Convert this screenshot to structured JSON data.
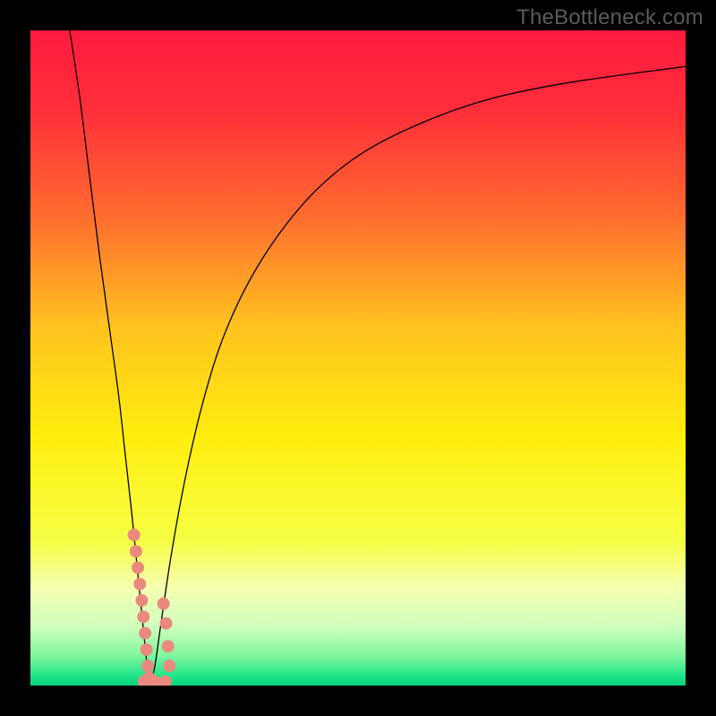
{
  "watermark": "TheBottleneck.com",
  "chart_data": {
    "type": "line",
    "title": "",
    "xlabel": "",
    "ylabel": "",
    "xlim": [
      0,
      100
    ],
    "ylim": [
      0,
      100
    ],
    "grid": false,
    "background_gradient": {
      "stops": [
        {
          "offset": 0.0,
          "color": "#ff1a3f"
        },
        {
          "offset": 0.12,
          "color": "#ff2e3a"
        },
        {
          "offset": 0.28,
          "color": "#ff6a2f"
        },
        {
          "offset": 0.45,
          "color": "#ffc21f"
        },
        {
          "offset": 0.62,
          "color": "#ffee0e"
        },
        {
          "offset": 0.78,
          "color": "#f6ff45"
        },
        {
          "offset": 0.85,
          "color": "#f6ffb0"
        },
        {
          "offset": 0.91,
          "color": "#d0ffbf"
        },
        {
          "offset": 0.955,
          "color": "#7ff59e"
        },
        {
          "offset": 0.985,
          "color": "#1fe58a"
        },
        {
          "offset": 1.0,
          "color": "#06d27a"
        }
      ]
    },
    "series": [
      {
        "name": "left-branch",
        "type": "line",
        "color": "#000000",
        "stroke_width": 1.3,
        "points": [
          {
            "x": 6.0,
            "y": 100.0
          },
          {
            "x": 7.5,
            "y": 90.0
          },
          {
            "x": 9.0,
            "y": 78.0
          },
          {
            "x": 10.5,
            "y": 66.0
          },
          {
            "x": 12.0,
            "y": 55.0
          },
          {
            "x": 13.5,
            "y": 44.0
          },
          {
            "x": 14.5,
            "y": 35.0
          },
          {
            "x": 15.5,
            "y": 26.0
          },
          {
            "x": 16.3,
            "y": 18.0
          },
          {
            "x": 17.0,
            "y": 11.0
          },
          {
            "x": 17.6,
            "y": 5.0
          },
          {
            "x": 18.0,
            "y": 1.5
          },
          {
            "x": 18.3,
            "y": 0.2
          }
        ]
      },
      {
        "name": "right-branch",
        "type": "line",
        "color": "#000000",
        "stroke_width": 1.3,
        "points": [
          {
            "x": 18.3,
            "y": 0.2
          },
          {
            "x": 19.0,
            "y": 3.0
          },
          {
            "x": 20.0,
            "y": 10.0
          },
          {
            "x": 21.5,
            "y": 20.0
          },
          {
            "x": 23.5,
            "y": 31.0
          },
          {
            "x": 26.0,
            "y": 42.0
          },
          {
            "x": 29.0,
            "y": 52.0
          },
          {
            "x": 33.0,
            "y": 61.0
          },
          {
            "x": 38.0,
            "y": 69.0
          },
          {
            "x": 44.0,
            "y": 76.0
          },
          {
            "x": 51.0,
            "y": 81.5
          },
          {
            "x": 60.0,
            "y": 86.0
          },
          {
            "x": 70.0,
            "y": 89.5
          },
          {
            "x": 82.0,
            "y": 92.0
          },
          {
            "x": 100.0,
            "y": 94.5
          }
        ]
      },
      {
        "name": "markers-left-cluster",
        "type": "scatter",
        "color": "#ea8a7e",
        "radius": 7,
        "points": [
          {
            "x": 15.8,
            "y": 23.0
          },
          {
            "x": 16.1,
            "y": 20.5
          },
          {
            "x": 16.4,
            "y": 18.0
          },
          {
            "x": 16.7,
            "y": 15.5
          },
          {
            "x": 17.0,
            "y": 13.0
          },
          {
            "x": 17.25,
            "y": 10.5
          },
          {
            "x": 17.5,
            "y": 8.0
          },
          {
            "x": 17.7,
            "y": 5.5
          },
          {
            "x": 17.9,
            "y": 3.0
          },
          {
            "x": 18.1,
            "y": 1.2
          }
        ]
      },
      {
        "name": "markers-right-cluster",
        "type": "scatter",
        "color": "#ea8a7e",
        "radius": 7,
        "points": [
          {
            "x": 20.3,
            "y": 12.5
          },
          {
            "x": 20.7,
            "y": 9.5
          },
          {
            "x": 21.0,
            "y": 6.0
          },
          {
            "x": 21.2,
            "y": 3.0
          }
        ]
      },
      {
        "name": "markers-bottom",
        "type": "scatter",
        "color": "#ea8a7e",
        "radius": 7,
        "points": [
          {
            "x": 17.3,
            "y": 0.6
          },
          {
            "x": 19.0,
            "y": 0.6
          },
          {
            "x": 20.6,
            "y": 0.6
          }
        ]
      }
    ]
  }
}
